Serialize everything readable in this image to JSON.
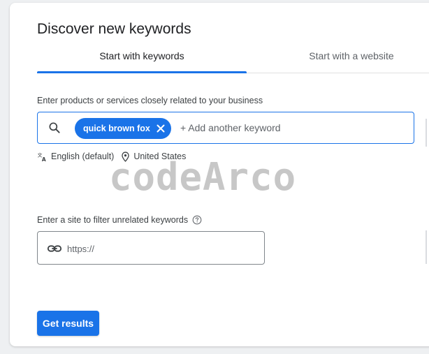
{
  "colors": {
    "accent": "#1a73e8",
    "text_primary": "#202124",
    "text_secondary": "#5f6368",
    "border": "#80868b"
  },
  "header": {
    "title": "Discover new keywords"
  },
  "tabs": [
    {
      "label": "Start with keywords",
      "selected": true
    },
    {
      "label": "Start with a website",
      "selected": false
    }
  ],
  "keywords_section": {
    "label": "Enter products or services closely related to your business",
    "search_icon": "search-icon",
    "chips": [
      {
        "text": "quick brown fox",
        "close_icon": "close-icon"
      }
    ],
    "input_value": "",
    "input_placeholder": "+ Add another keyword",
    "language": "English (default)",
    "language_icon": "translate-icon",
    "location": "United States",
    "location_icon": "location-pin-icon"
  },
  "watermark": "codeArco",
  "site_section": {
    "label": "Enter a site to filter unrelated keywords",
    "help_icon": "help-icon",
    "link_icon": "link-icon",
    "input_value": "",
    "input_placeholder": "https://"
  },
  "actions": {
    "get_results_label": "Get results"
  }
}
